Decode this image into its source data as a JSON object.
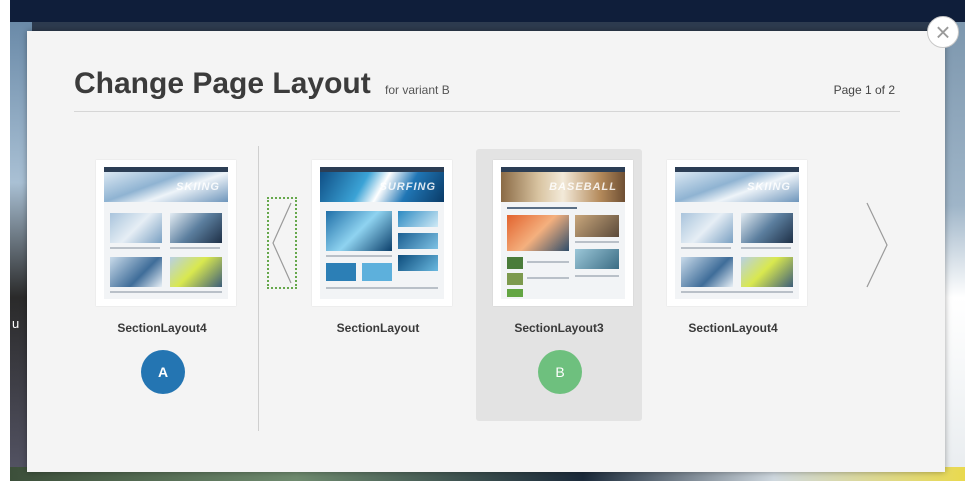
{
  "modal": {
    "title": "Change Page Layout",
    "subtitle": "for variant B",
    "page_indicator": "Page 1 of 2",
    "close_glyph": "×"
  },
  "background": {
    "side_text": "u"
  },
  "current_layout": {
    "label": "SectionLayout4",
    "variant_badge": "A",
    "hero_word": "SKIING"
  },
  "layouts": [
    {
      "label": "SectionLayout",
      "hero_word": "SURFING",
      "selected": false
    },
    {
      "label": "SectionLayout3",
      "hero_word": "BASEBALL",
      "selected": true,
      "variant_badge": "B"
    },
    {
      "label": "SectionLayout4",
      "hero_word": "SKIING",
      "selected": false
    }
  ],
  "icons": {
    "close": "close-icon",
    "prev": "chevron-left-icon",
    "next": "chevron-right-icon"
  },
  "colors": {
    "variant_a": "#2475b2",
    "variant_b": "#6ec07e",
    "selected_card": "#e3e3e3",
    "title": "#3b3b3b"
  }
}
